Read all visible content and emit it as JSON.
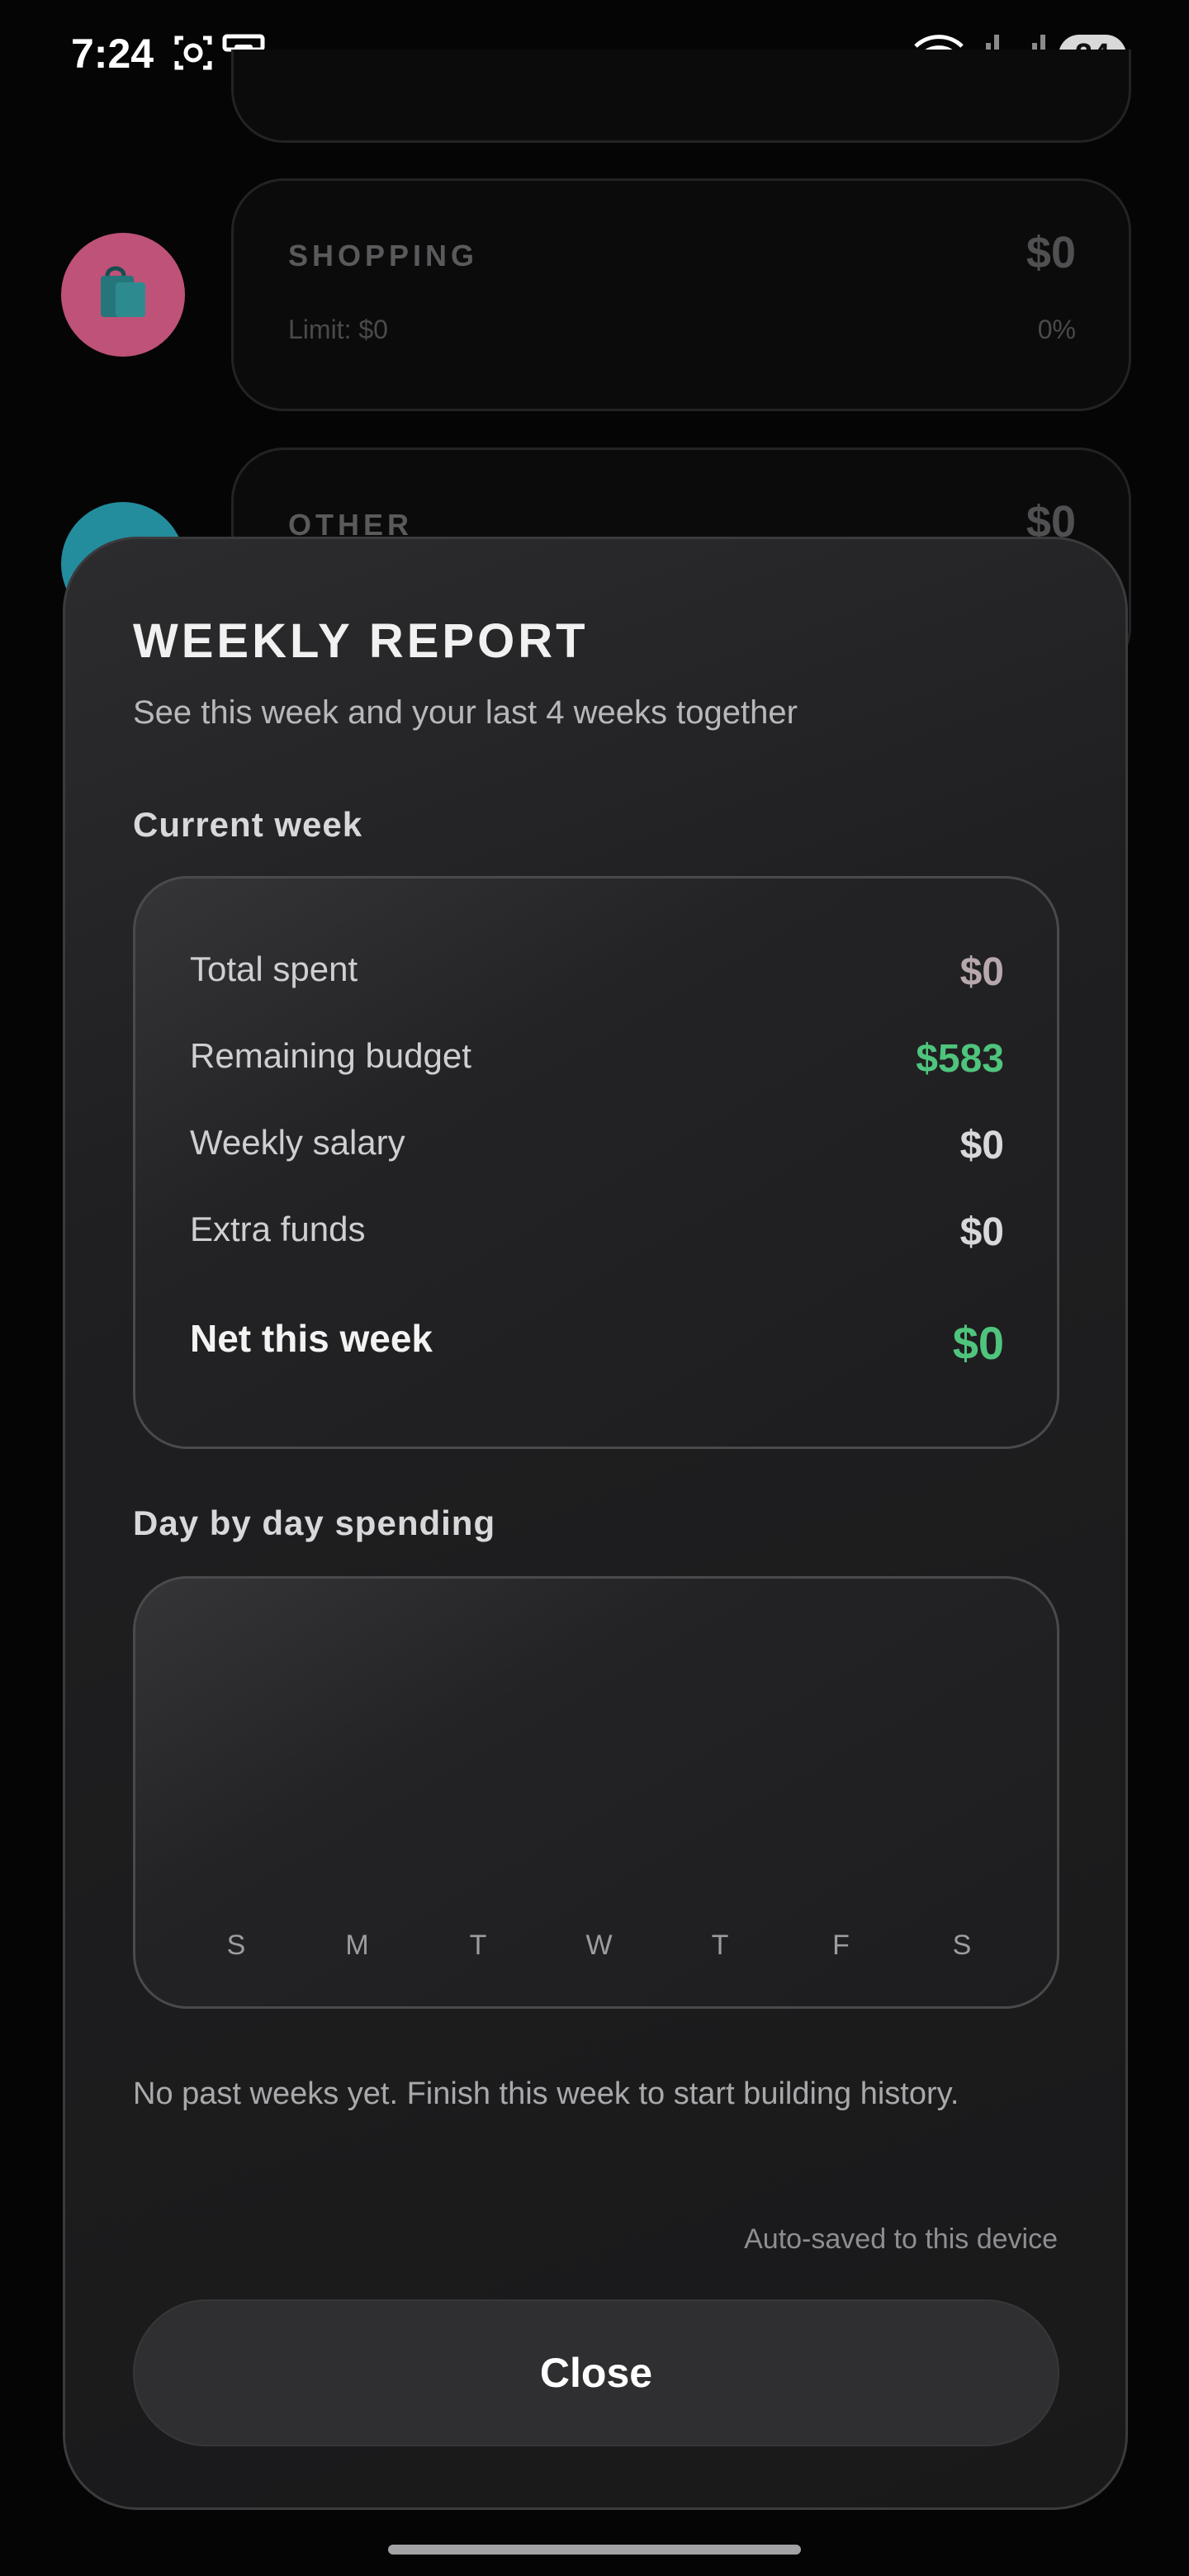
{
  "status_bar": {
    "time": "7:24",
    "battery": "24",
    "icons": [
      "screenshot-icon",
      "device-icon",
      "wifi-6e-icon",
      "signal-icon",
      "signal-icon"
    ]
  },
  "background": {
    "categories": [
      {
        "name": "SHOPPING",
        "amount": "$0",
        "limit": "Limit: $0",
        "percent": "0%",
        "color": "#e0608c",
        "icon": "shopping-bag-icon"
      },
      {
        "name": "OTHER",
        "amount": "$0",
        "color": "#2aa6b8"
      }
    ]
  },
  "sheet": {
    "title": "WEEKLY REPORT",
    "subtitle": "See this week and your last 4 weeks together",
    "current_week": {
      "label": "Current week",
      "rows": [
        {
          "label": "Total spent",
          "value": "$0",
          "color": "#b7a8ad"
        },
        {
          "label": "Remaining budget",
          "value": "$583",
          "color": "#4fc47d"
        },
        {
          "label": "Weekly salary",
          "value": "$0",
          "color": "#d8d8da"
        },
        {
          "label": "Extra funds",
          "value": "$0",
          "color": "#d8d8da"
        }
      ],
      "net": {
        "label": "Net this week",
        "value": "$0",
        "color": "#4fc47d"
      }
    },
    "day_chart": {
      "label": "Day by day spending",
      "days": [
        "S",
        "M",
        "T",
        "W",
        "T",
        "F",
        "S"
      ]
    },
    "history_note": "No past weeks yet. Finish this week to start building history.",
    "autosave_text": "Auto-saved to this device",
    "close_label": "Close"
  },
  "chart_data": {
    "type": "bar",
    "title": "Day by day spending",
    "categories": [
      "S",
      "M",
      "T",
      "W",
      "T",
      "F",
      "S"
    ],
    "values": [
      0,
      0,
      0,
      0,
      0,
      0,
      0
    ]
  }
}
